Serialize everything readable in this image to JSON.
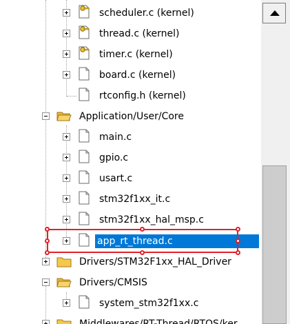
{
  "tree": {
    "items": [
      {
        "label": "scheduler.c (kernel)",
        "kind": "file-key"
      },
      {
        "label": "thread.c (kernel)",
        "kind": "file-key"
      },
      {
        "label": "timer.c (kernel)",
        "kind": "file-key"
      },
      {
        "label": "board.c (kernel)",
        "kind": "file"
      },
      {
        "label": "rtconfig.h (kernel)",
        "kind": "file"
      },
      {
        "label": "Application/User/Core",
        "kind": "folder"
      },
      {
        "label": "main.c",
        "kind": "file"
      },
      {
        "label": "gpio.c",
        "kind": "file"
      },
      {
        "label": "usart.c",
        "kind": "file"
      },
      {
        "label": "stm32f1xx_it.c",
        "kind": "file"
      },
      {
        "label": "stm32f1xx_hal_msp.c",
        "kind": "file"
      },
      {
        "label": "app_rt_thread.c",
        "kind": "file",
        "selected": true
      },
      {
        "label": "Drivers/STM32F1xx_HAL_Driver",
        "kind": "folder"
      },
      {
        "label": "Drivers/CMSIS",
        "kind": "folder"
      },
      {
        "label": "system_stm32f1xx.c",
        "kind": "file"
      },
      {
        "label": "Middlewares/RT-Thread/RTOS/ker",
        "kind": "folder"
      }
    ]
  },
  "colors": {
    "selection": "#0078d7",
    "annotation": "#e0202a",
    "folder": "#f5c84c"
  },
  "icons": {
    "file": "document-icon",
    "file_key": "key-document-icon",
    "folder": "folder-icon",
    "folder_open": "folder-open-icon"
  }
}
